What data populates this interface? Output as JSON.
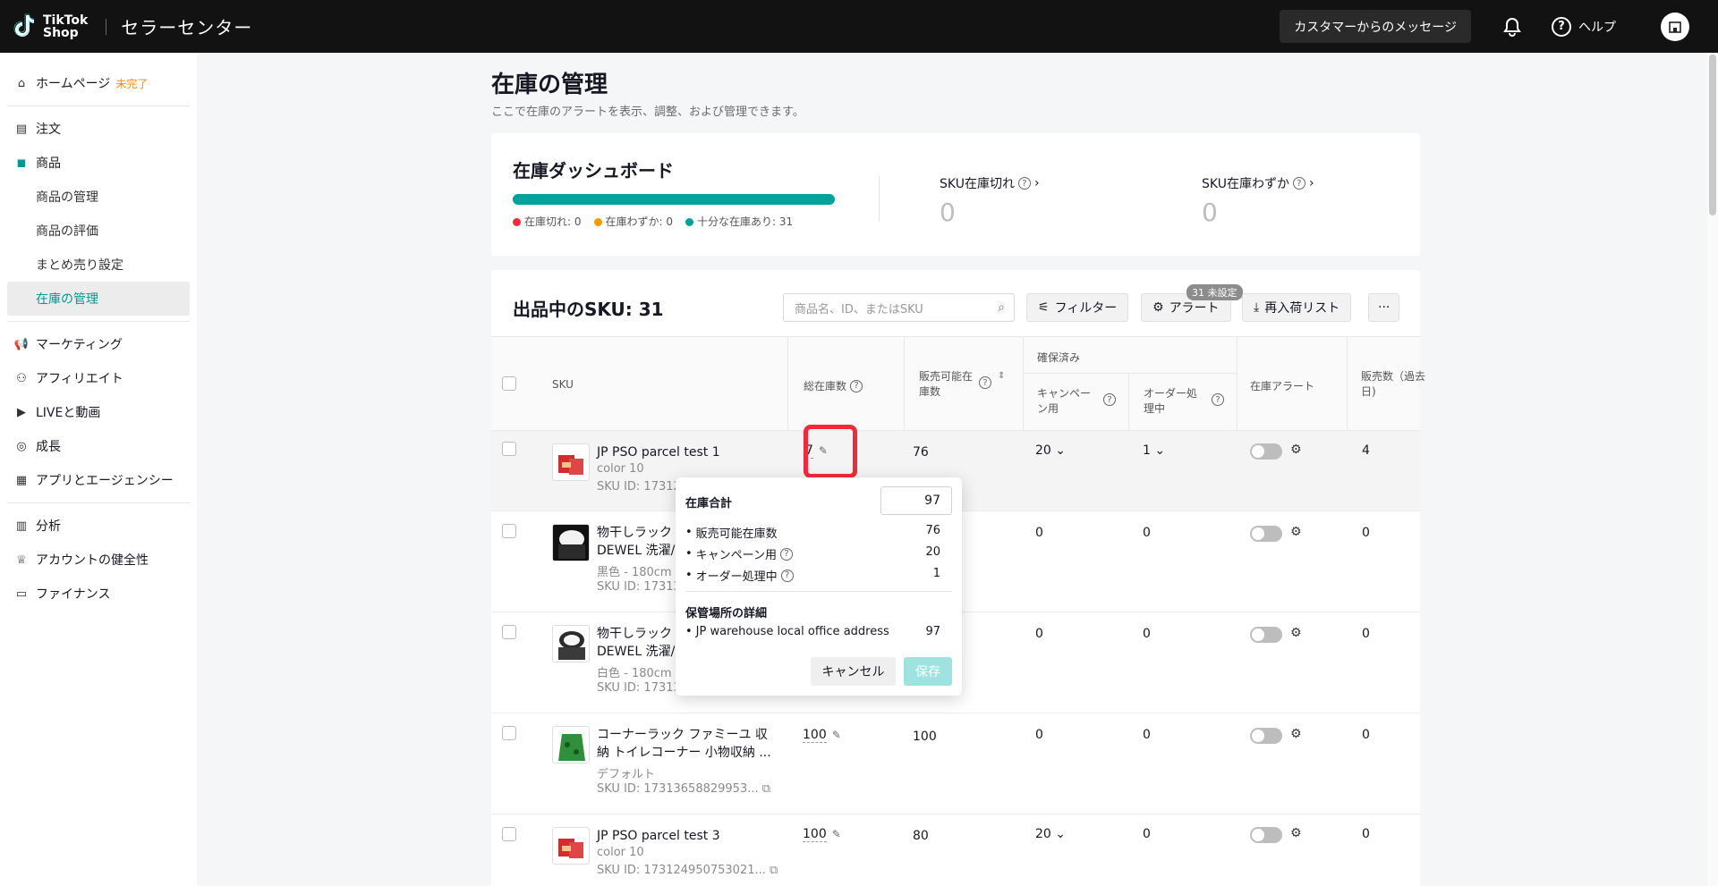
{
  "header": {
    "brand_line1": "TikTok",
    "brand_line2": "Shop",
    "title": "セラーセンター",
    "message_btn": "カスタマーからのメッセージ",
    "help": "ヘルプ"
  },
  "sidebar": {
    "items": [
      {
        "label": "ホームページ",
        "badge": "未完了",
        "icon": "home-icon"
      },
      {
        "label": "注文",
        "icon": "order-icon"
      },
      {
        "label": "商品",
        "icon": "product-icon"
      },
      {
        "label": "マーケティング",
        "icon": "megaphone-icon"
      },
      {
        "label": "アフィリエイト",
        "icon": "affiliate-icon"
      },
      {
        "label": "LIVEと動画",
        "icon": "video-icon"
      },
      {
        "label": "成長",
        "icon": "medal-icon"
      },
      {
        "label": "アプリとエージェンシー",
        "icon": "apps-icon"
      },
      {
        "label": "分析",
        "icon": "chart-icon"
      },
      {
        "label": "アカウントの健全性",
        "icon": "trophy-icon"
      },
      {
        "label": "ファイナンス",
        "icon": "wallet-icon"
      }
    ],
    "sub": [
      "商品の管理",
      "商品の評価",
      "まとめ売り設定",
      "在庫の管理"
    ]
  },
  "page": {
    "title": "在庫の管理",
    "subtitle": "ここで在庫のアラートを表示、調整、および管理できます。"
  },
  "dashboard": {
    "title": "在庫ダッシュボード",
    "legend": [
      "在庫切れ: 0",
      "在庫わずか: 0",
      "十分な在庫あり: 31"
    ],
    "legend_colors": [
      "#f5283a",
      "#f59a00",
      "#00a39a"
    ],
    "healthy_fraction": 1.0,
    "kpi1_label": "SKU在庫切れ",
    "kpi1_value": "0",
    "kpi2_label": "SKU在庫わずか",
    "kpi2_value": "0"
  },
  "table": {
    "heading": "出品中のSKU: 31",
    "search_placeholder": "商品名、ID、またはSKU",
    "filter": "フィルター",
    "alert": "アラート",
    "alert_badge": "31 未設定",
    "restock": "再入荷リスト",
    "more": "···",
    "headers": {
      "sku": "SKU",
      "total": "総在庫数",
      "available_l1": "販売可能在",
      "available_l2": "庫数",
      "reserved": "確保済み",
      "campaign_l1": "キャンペー",
      "campaign_l2": "ン用",
      "order_l1": "オーダー処",
      "order_l2": "理中",
      "alert": "在庫アラート",
      "sales_l1": "販売数（過去",
      "sales_l2": "日)"
    },
    "rows": [
      {
        "name1": "JP PSO parcel test 1",
        "name2": "",
        "variant": "color 10",
        "sku": "SKU ID: 17312",
        "total": "7",
        "available": "76",
        "campaign": "20",
        "order": "1",
        "sales": "4"
      },
      {
        "name1": "物干しラック",
        "name2": "DEWEL 洗濯/",
        "variant": "黒色 - 180cm",
        "sku": "SKU ID: 17313",
        "total": "",
        "available": "",
        "campaign": "0",
        "order": "0",
        "sales": "0"
      },
      {
        "name1": "物干しラック",
        "name2": "DEWEL 洗濯/",
        "variant": "白色 - 180cm",
        "sku": "SKU ID: 17313",
        "total": "",
        "available": "",
        "campaign": "0",
        "order": "0",
        "sales": "0"
      },
      {
        "name1": "コーナーラック ファミーユ 収",
        "name2": "納 トイレコーナー 小物収納 ...",
        "variant": "デフォルト",
        "sku": "SKU ID: 17313658829953...",
        "total": "100",
        "available": "100",
        "campaign": "0",
        "order": "0",
        "sales": "0"
      },
      {
        "name1": "JP PSO parcel test 3",
        "name2": "",
        "variant": "color 10",
        "sku": "SKU ID: 173124950753021...",
        "total": "100",
        "available": "80",
        "campaign": "20",
        "order": "0",
        "sales": "0"
      }
    ]
  },
  "popover": {
    "title": "在庫合計",
    "total_value": "97",
    "lines": [
      {
        "label": "販売可能在庫数",
        "value": "76"
      },
      {
        "label": "キャンペーン用",
        "value": "20"
      },
      {
        "label": "オーダー処理中",
        "value": "1"
      }
    ],
    "location_title": "保管場所の詳細",
    "location_label": "JP warehouse local office address",
    "location_value": "97",
    "cancel": "キャンセル",
    "save": "保存"
  }
}
